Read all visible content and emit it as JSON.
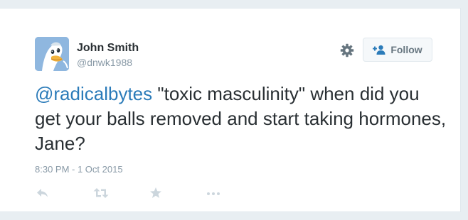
{
  "author": {
    "name": "John Smith",
    "handle": "@dnwk1988"
  },
  "follow_button": {
    "label": "Follow",
    "icon": "follow-person-plus-icon"
  },
  "tweet": {
    "mention": "@radicalbytes",
    "text": " \"toxic masculinity\" when did you get your balls removed and start taking hormones, Jane?",
    "timestamp": "8:30 PM - 1 Oct 2015"
  },
  "icons": {
    "settings": "gear-icon",
    "reply": "reply-icon",
    "retweet": "retweet-icon",
    "favorite": "star-icon",
    "more": "more-dots-icon"
  },
  "colors": {
    "text": "#292f33",
    "muted": "#8899a6",
    "link": "#2b7bb9",
    "action_icons": "#ccd6dd",
    "background": "#e8eef2"
  }
}
